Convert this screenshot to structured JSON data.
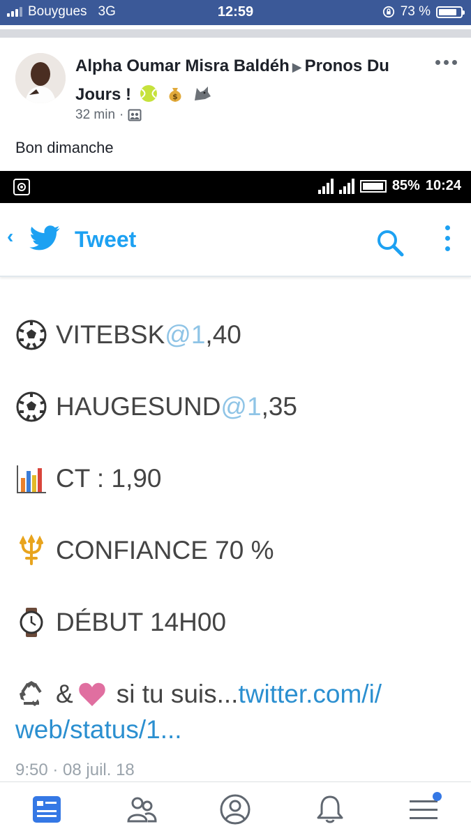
{
  "ios_status": {
    "carrier": "Bouygues",
    "network": "3G",
    "time": "12:59",
    "battery": "73 %",
    "battery_level": 0.73
  },
  "post": {
    "author": "Alpha Oumar Misra Baldéh",
    "target_group": "Pronos Du Jours !",
    "title_emojis": [
      "tennis-ball-icon",
      "money-bag-icon",
      "wolf-icon"
    ],
    "time": "32 min",
    "audience_icon": "group-audience-icon",
    "text": "Bon dimanche"
  },
  "embedded_screenshot": {
    "android_status": {
      "battery": "85%",
      "time": "10:24",
      "battery_level": 0.85
    },
    "twitter_header": {
      "title": "Tweet"
    },
    "tweet_lines": [
      {
        "icon": "soccer-ball-icon",
        "text": "VITEBSK ",
        "mention": "@1",
        "suffix": ",40"
      },
      {
        "icon": "soccer-ball-icon",
        "text": "HAUGESUND ",
        "mention": "@1",
        "suffix": ",35"
      },
      {
        "icon": "bar-chart-icon",
        "text": "CT : 1,90"
      },
      {
        "icon": "trident-icon",
        "text": "CONFIANCE 70 %"
      },
      {
        "icon": "watch-icon",
        "text": "DÉBUT 14H00"
      }
    ],
    "tweet_footer": {
      "text": "& ",
      "text2": " si tu suis... ",
      "link_part1": "twitter.com/i/",
      "link_part2": "web/status/1..."
    },
    "tweet_time": "9:50 · 08 juil. 18"
  },
  "tabbar": {
    "items": [
      "news-feed-icon",
      "friends-icon",
      "profile-icon",
      "notifications-icon",
      "menu-icon"
    ]
  },
  "colors": {
    "facebook_blue": "#3b5998",
    "twitter_blue": "#1da1f2",
    "link_blue": "#2b8fd0",
    "tab_active": "#3578e5"
  }
}
